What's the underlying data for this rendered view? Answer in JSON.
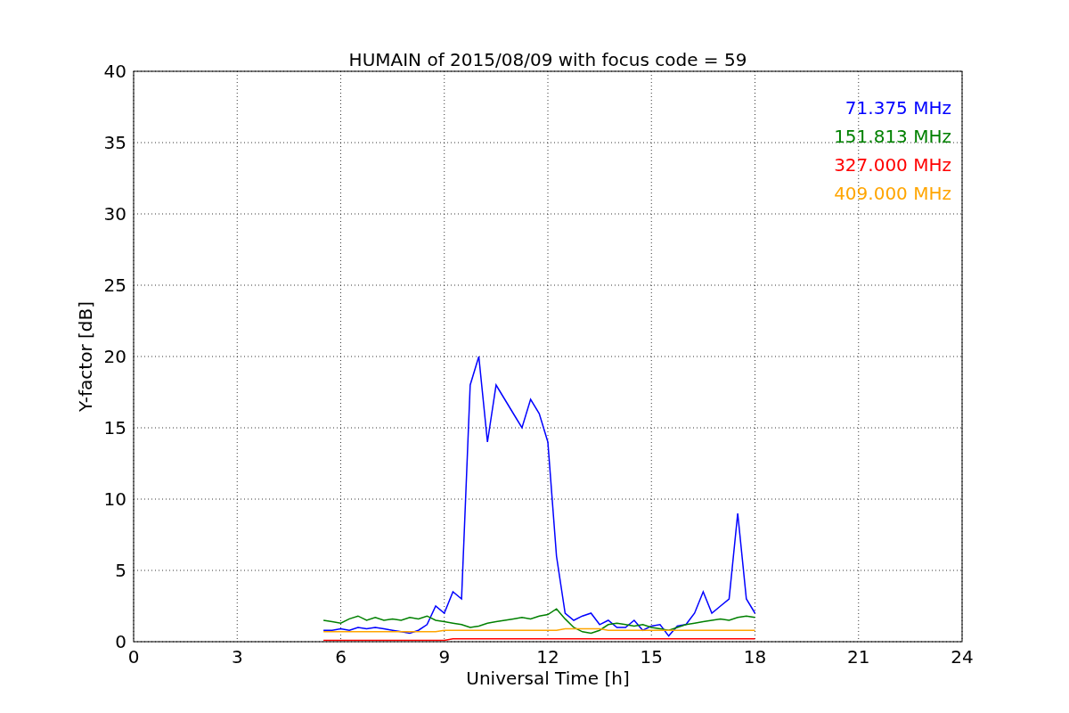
{
  "chart_data": {
    "type": "line",
    "title": "HUMAIN of 2015/08/09 with focus code = 59",
    "xlabel": "Universal Time [h]",
    "ylabel": "Y-factor [dB]",
    "x": [
      5.5,
      5.75,
      6,
      6.25,
      6.5,
      6.75,
      7,
      7.25,
      7.5,
      7.75,
      8,
      8.25,
      8.5,
      8.75,
      9,
      9.25,
      9.5,
      9.75,
      10,
      10.25,
      10.5,
      10.75,
      11,
      11.25,
      11.5,
      11.75,
      12,
      12.25,
      12.5,
      12.75,
      13,
      13.25,
      13.5,
      13.75,
      14,
      14.25,
      14.5,
      14.75,
      15,
      15.25,
      15.5,
      15.75,
      16,
      16.25,
      16.5,
      16.75,
      17,
      17.25,
      17.5,
      17.75,
      18
    ],
    "series": [
      {
        "name": "71.375 MHz",
        "color": "#0000ff",
        "values": [
          0.8,
          0.8,
          0.9,
          0.8,
          1.0,
          0.9,
          1.0,
          0.9,
          0.8,
          0.7,
          0.6,
          0.8,
          1.2,
          2.5,
          2.0,
          3.5,
          3.0,
          18,
          20,
          14,
          18,
          17,
          16,
          15,
          17,
          16,
          14,
          6,
          2,
          1.5,
          1.8,
          2,
          1.2,
          1.5,
          1.0,
          1.0,
          1.5,
          0.8,
          1.1,
          1.2,
          0.4,
          1.1,
          1.2,
          2.0,
          3.5,
          2.0,
          2.5,
          3,
          9,
          3,
          2
        ]
      },
      {
        "name": "151.813 MHz",
        "color": "#008000",
        "values": [
          1.5,
          1.4,
          1.3,
          1.6,
          1.8,
          1.5,
          1.7,
          1.5,
          1.6,
          1.5,
          1.7,
          1.6,
          1.8,
          1.5,
          1.4,
          1.3,
          1.2,
          1.0,
          1.1,
          1.3,
          1.4,
          1.5,
          1.6,
          1.7,
          1.6,
          1.8,
          1.9,
          2.3,
          1.6,
          1.0,
          0.7,
          0.6,
          0.8,
          1.2,
          1.3,
          1.2,
          1.1,
          1.2,
          1.0,
          0.9,
          0.8,
          1.0,
          1.2,
          1.3,
          1.4,
          1.5,
          1.6,
          1.5,
          1.7,
          1.8,
          1.7
        ]
      },
      {
        "name": "327.000 MHz",
        "color": "#ff0000",
        "values": [
          0.1,
          0.1,
          0.1,
          0.1,
          0.1,
          0.1,
          0.1,
          0.1,
          0.1,
          0.1,
          0.1,
          0.1,
          0.1,
          0.1,
          0.1,
          0.2,
          0.2,
          0.2,
          0.2,
          0.2,
          0.2,
          0.2,
          0.2,
          0.2,
          0.2,
          0.2,
          0.2,
          0.2,
          0.2,
          0.2,
          0.2,
          0.2,
          0.2,
          0.2,
          0.2,
          0.2,
          0.2,
          0.2,
          0.2,
          0.2,
          0.2,
          0.2,
          0.2,
          0.2,
          0.2,
          0.2,
          0.2,
          0.2,
          0.2,
          0.2,
          0.2
        ]
      },
      {
        "name": "409.000 MHz",
        "color": "#ffa500",
        "values": [
          0.7,
          0.7,
          0.7,
          0.7,
          0.7,
          0.7,
          0.7,
          0.7,
          0.7,
          0.7,
          0.7,
          0.7,
          0.7,
          0.7,
          0.8,
          0.8,
          0.8,
          0.8,
          0.8,
          0.8,
          0.8,
          0.8,
          0.8,
          0.8,
          0.8,
          0.8,
          0.8,
          0.8,
          0.9,
          0.9,
          0.9,
          0.9,
          0.9,
          0.8,
          0.8,
          0.8,
          0.8,
          0.8,
          0.8,
          0.8,
          0.8,
          0.8,
          0.8,
          0.8,
          0.8,
          0.8,
          0.8,
          0.8,
          0.8,
          0.8,
          0.8
        ]
      }
    ],
    "grid": true,
    "xlim": [
      0,
      24
    ],
    "ylim": [
      0,
      40
    ],
    "xticks": [
      0,
      3,
      6,
      9,
      12,
      15,
      18,
      21,
      24
    ],
    "yticks": [
      0,
      5,
      10,
      15,
      20,
      25,
      30,
      35,
      40
    ]
  }
}
